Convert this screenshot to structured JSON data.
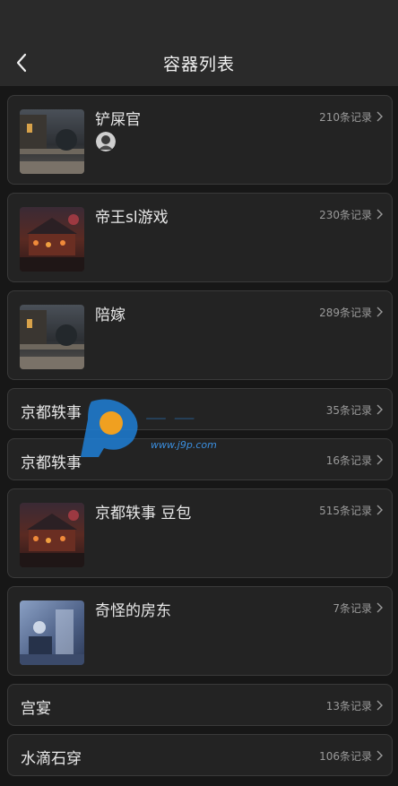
{
  "header": {
    "title": "容器列表"
  },
  "items": [
    {
      "name": "铲屎官",
      "count": "210条记录",
      "thumb": "scene-night-house",
      "avatar": true
    },
    {
      "name": "帝王sl游戏",
      "count": "230条记录",
      "thumb": "scene-red-lanterns"
    },
    {
      "name": "陪嫁",
      "count": "289条记录",
      "thumb": "scene-night-house"
    },
    {
      "name": "京都轶事",
      "count": "35条记录"
    },
    {
      "name": "京都轶事",
      "count": "16条记录"
    },
    {
      "name": "京都轶事 豆包",
      "count": "515条记录",
      "thumb": "scene-red-lanterns"
    },
    {
      "name": "奇怪的房东",
      "count": "7条记录",
      "thumb": "scene-blue-room"
    },
    {
      "name": "宫宴",
      "count": "13条记录"
    },
    {
      "name": "水滴石穿",
      "count": "106条记录"
    }
  ],
  "watermark": {
    "text": "www.j9p.com"
  }
}
